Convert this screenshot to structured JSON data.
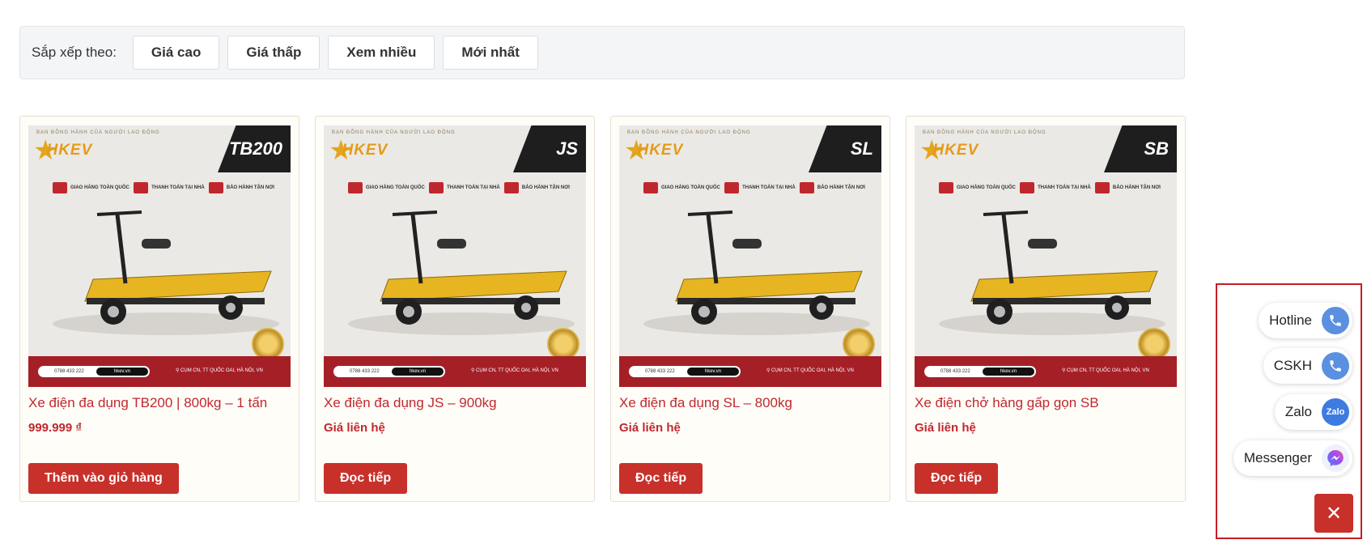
{
  "sort": {
    "label": "Sắp xếp theo:",
    "options": [
      "Giá cao",
      "Giá thấp",
      "Xem nhiều",
      "Mới nhất"
    ]
  },
  "products": [
    {
      "model": "TB200",
      "title": "Xe điện đa dụng TB200 | 800kg – 1 tấn",
      "price": "999.999 ₫",
      "action": "Thêm vào giỏ hàng"
    },
    {
      "model": "JS",
      "title": "Xe điện đa dụng JS – 900kg",
      "price": "Giá liên hệ",
      "action": "Đọc tiếp"
    },
    {
      "model": "SL",
      "title": "Xe điện đa dụng SL – 800kg",
      "price": "Giá liên hệ",
      "action": "Đọc tiếp"
    },
    {
      "model": "SB",
      "title": "Xe điện chở hàng gấp gọn SB",
      "price": "Giá liên hệ",
      "action": "Đọc tiếp"
    }
  ],
  "banner": {
    "brand": "HKEV",
    "tagline": "BẠN ĐỒNG HÀNH CỦA NGƯỜI LAO ĐỘNG",
    "benefits": [
      "GIAO HÀNG TOÀN QUỐC",
      "THANH TOÁN TẠI NHÀ",
      "BẢO HÀNH TẬN NƠI"
    ],
    "phone": "0788 433 222",
    "website": "hkev.vn",
    "address": "CỤM CN, TT QUỐC OAI, HÀ NỘI, VN"
  },
  "contact": {
    "items": [
      {
        "label": "Hotline",
        "icon": "phone-icon"
      },
      {
        "label": "CSKH",
        "icon": "phone-icon"
      },
      {
        "label": "Zalo",
        "icon": "zalo-icon",
        "icon_text": "Zalo"
      },
      {
        "label": "Messenger",
        "icon": "messenger-icon"
      }
    ],
    "close_icon": "close-icon",
    "accent": "#c8302a"
  }
}
